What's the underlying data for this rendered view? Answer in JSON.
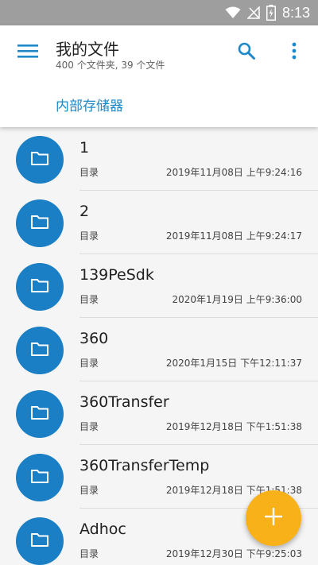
{
  "status_bar": {
    "time": "8:13",
    "icons": [
      "wifi-icon",
      "signal-icon",
      "battery-icon"
    ]
  },
  "app_bar": {
    "title": "我的文件",
    "subtitle": "400 个文件夹, 39 个文件",
    "menu_icon": "hamburger-menu-icon",
    "search_icon": "search-icon",
    "more_icon": "more-vert-icon"
  },
  "breadcrumb": {
    "label": "内部存储器"
  },
  "files": [
    {
      "name": "1",
      "type": "目录",
      "date": "2019年11月08日 上午9:24:16"
    },
    {
      "name": "2",
      "type": "目录",
      "date": "2019年11月08日 上午9:24:17"
    },
    {
      "name": "139PeSdk",
      "type": "目录",
      "date": "2020年1月19日 上午9:36:00"
    },
    {
      "name": "360",
      "type": "目录",
      "date": "2020年1月15日 下午12:11:37"
    },
    {
      "name": "360Transfer",
      "type": "目录",
      "date": "2019年12月18日 下午1:51:38"
    },
    {
      "name": "360TransferTemp",
      "type": "目录",
      "date": "2019年12月18日 下午1:51:38"
    },
    {
      "name": "Adhoc",
      "type": "目录",
      "date": "2019年12月30日 下午9:25:03"
    }
  ],
  "fab": {
    "icon": "add-icon"
  },
  "colors": {
    "accent": "#1e88c8",
    "folder_circle": "#1a7fc4",
    "fab": "#f9b11a",
    "status_bar": "#9e9e9e"
  }
}
